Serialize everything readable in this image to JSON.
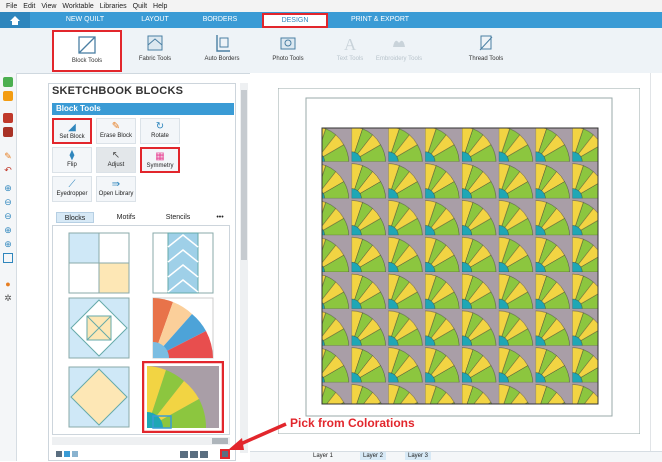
{
  "menu": [
    "File",
    "Edit",
    "View",
    "Worktable",
    "Libraries",
    "Quilt",
    "Help"
  ],
  "tabs": {
    "new_quilt": "NEW QUILT",
    "layout": "LAYOUT",
    "borders": "BORDERS",
    "design": "DESIGN",
    "print_export": "PRINT & EXPORT"
  },
  "ribbon": {
    "block_tools": "Block Tools",
    "fabric_tools": "Fabric Tools",
    "auto_borders": "Auto Borders",
    "photo_tools": "Photo Tools",
    "text_tools": "Text Tools",
    "embroidery_tools": "Embroidery Tools",
    "thread_tools": "Thread Tools"
  },
  "palette": {
    "title": "SKETCHBOOK BLOCKS",
    "section": "Block Tools",
    "tools": {
      "set_block": "Set Block",
      "erase_block": "Erase Block",
      "rotate": "Rotate",
      "flip": "Flip",
      "adjust": "Adjust",
      "symmetry": "Symmetry",
      "eyedropper": "Eyedropper",
      "open_library": "Open Library"
    },
    "subtabs": {
      "blocks": "Blocks",
      "motifs": "Motifs",
      "stencils": "Stencils",
      "more": "•••"
    }
  },
  "layers": [
    "Layer 1",
    "Layer 2",
    "Layer 3"
  ],
  "callout": "Pick from Colorations",
  "colors": {
    "accent": "#3a9bd5",
    "highlight": "#e2262c",
    "fan_yellow": "#f2d443",
    "fan_green": "#8cc63f",
    "teal": "#1fa7b5",
    "bg_gray": "#a99ea7"
  }
}
